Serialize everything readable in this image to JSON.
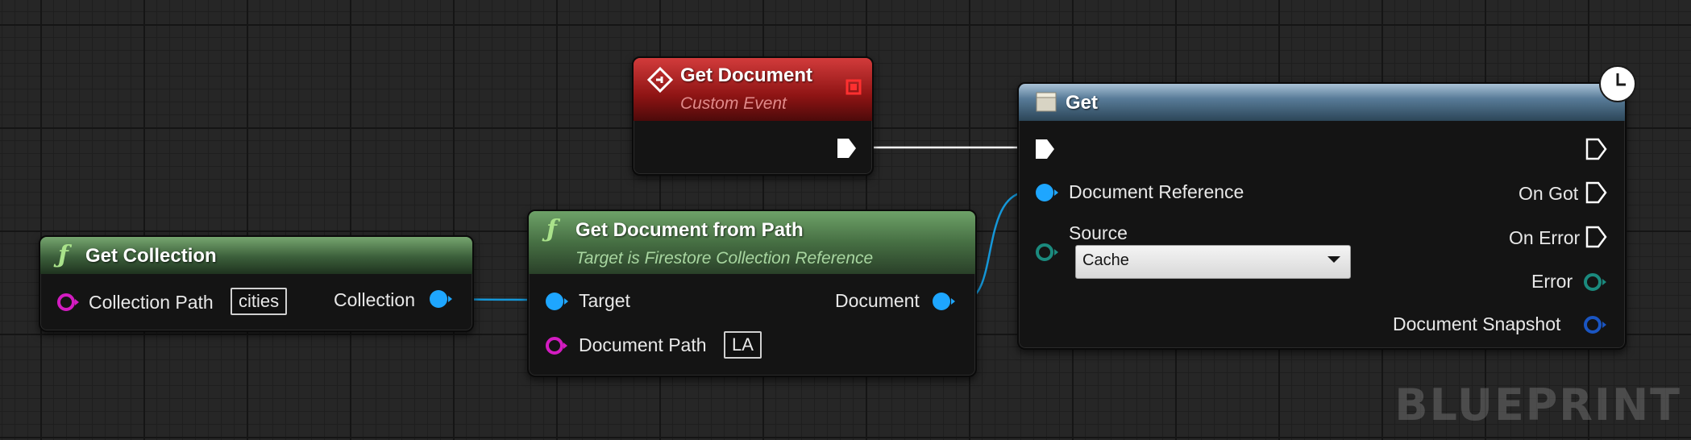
{
  "watermark": "BLUEPRINT",
  "colors": {
    "object_pin": "#1ea6ff",
    "string_pin": "#d31cc1",
    "error_pin": "#1b8a7e",
    "snapshot_pin": "#1a55c2",
    "exec_pin": "#ffffff",
    "wire_object": "#1597d8",
    "wire_exec": "#ffffff"
  },
  "nodes": {
    "get_collection": {
      "icon": "function-icon",
      "title": "Get Collection",
      "collection_path_label": "Collection Path",
      "collection_path_value": "cities",
      "output_label": "Collection"
    },
    "get_document_event": {
      "icon": "event-icon",
      "title": "Get Document",
      "subtitle": "Custom Event"
    },
    "get_document_from_path": {
      "icon": "function-icon",
      "title": "Get Document from Path",
      "subtitle": "Target is Firestore Collection Reference",
      "target_label": "Target",
      "document_path_label": "Document Path",
      "document_path_value": "LA",
      "output_label": "Document"
    },
    "get": {
      "icon": "async-clock-icon",
      "title": "Get",
      "document_reference_label": "Document Reference",
      "source_label": "Source",
      "source_value": "Cache",
      "on_got_label": "On Got",
      "on_error_label": "On Error",
      "error_label": "Error",
      "document_snapshot_label": "Document Snapshot"
    }
  }
}
